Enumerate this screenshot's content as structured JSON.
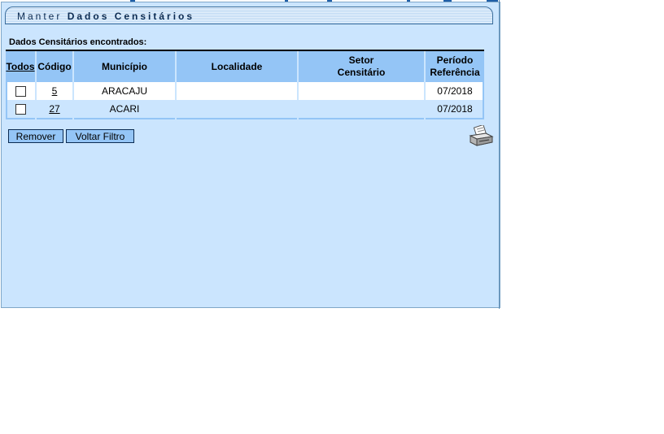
{
  "title": {
    "prefix": "Manter ",
    "bold": "Dados Censitários"
  },
  "found_label": "Dados Censitários encontrados:",
  "table": {
    "headers": {
      "todos": "Todos",
      "codigo": "Código",
      "municipio": "Município",
      "localidade": "Localidade",
      "setor_line1": "Setor",
      "setor_line2": "Censitário",
      "periodo_line1": "Período",
      "periodo_line2": "Referência"
    },
    "rows": [
      {
        "codigo": "5",
        "municipio": "ARACAJU",
        "localidade": "",
        "setor": "",
        "periodo": "07/2018",
        "checked": false
      },
      {
        "codigo": "27",
        "municipio": "ACARI",
        "localidade": "",
        "setor": "",
        "periodo": "07/2018",
        "checked": false
      }
    ]
  },
  "buttons": {
    "remover": "Remover",
    "voltar_filtro": "Voltar Filtro"
  },
  "icons": {
    "print": "printer-icon"
  },
  "colors": {
    "panel_bg": "#cbe5fe",
    "header_bg": "#94c5f6",
    "row_white": "#ffffff",
    "title_text": "#0b2b52"
  }
}
